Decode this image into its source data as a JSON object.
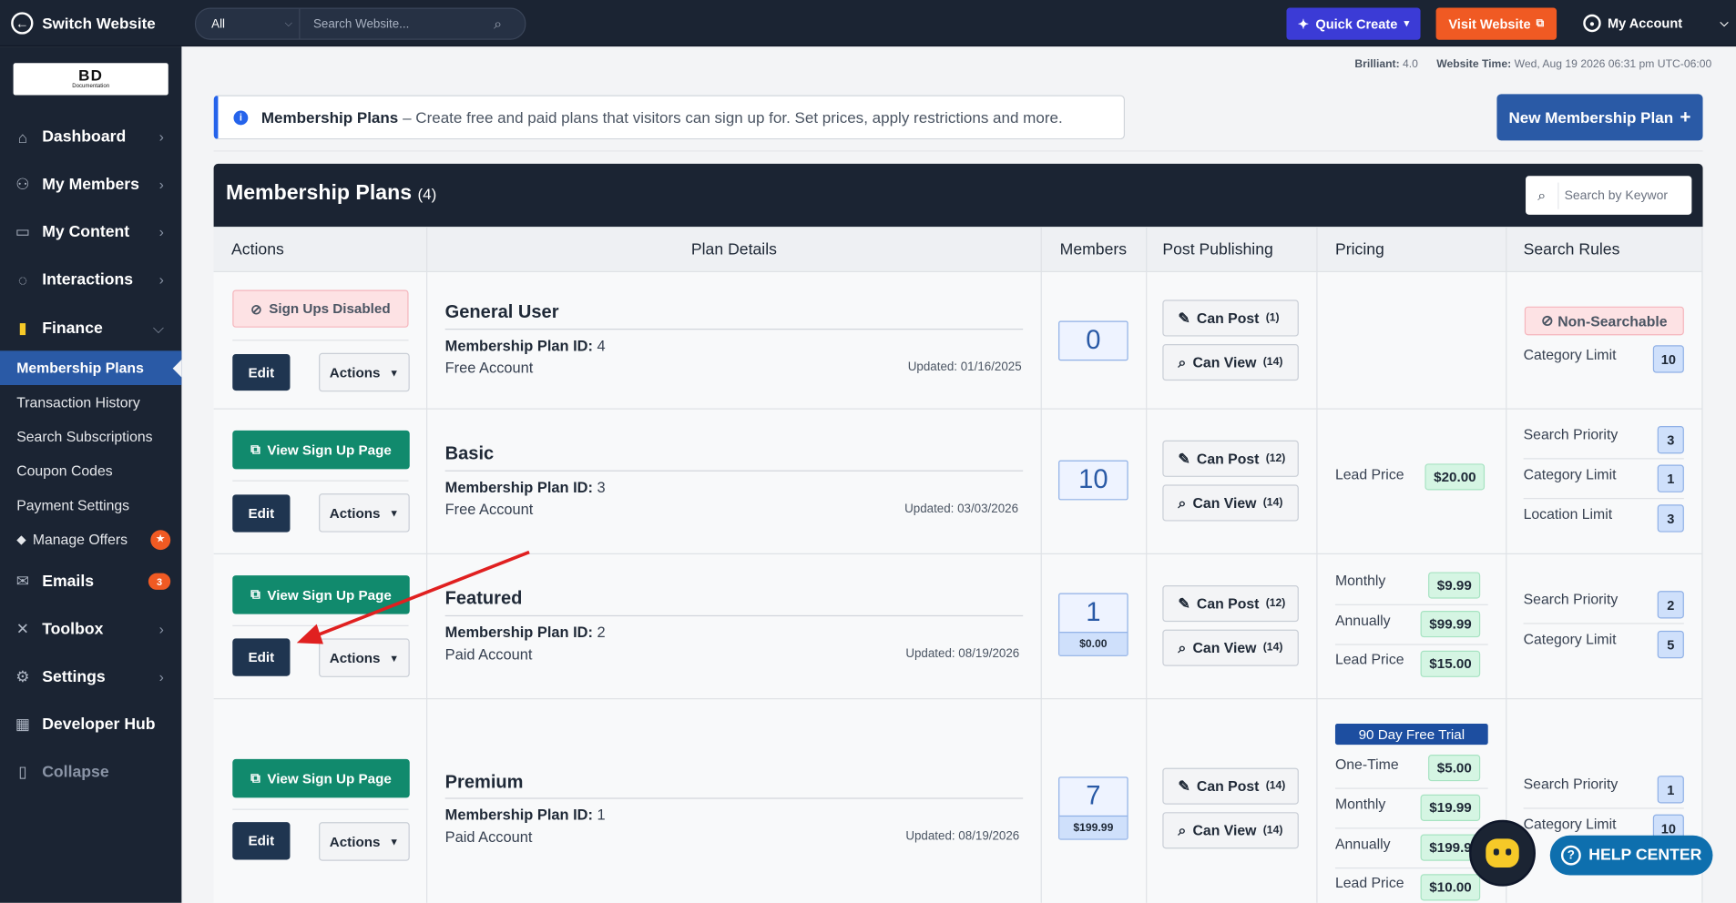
{
  "topbar": {
    "switch_label": "Switch Website",
    "scope_select": "All",
    "search_placeholder": "Search Website...",
    "quick_create": "Quick Create",
    "visit_website": "Visit Website",
    "my_account": "My Account"
  },
  "logo": {
    "text": "BD",
    "subtext": "Documentation"
  },
  "sidebar": {
    "items": [
      {
        "label": "Dashboard",
        "icon": "home-icon"
      },
      {
        "label": "My Members",
        "icon": "members-icon"
      },
      {
        "label": "My Content",
        "icon": "folder-icon"
      },
      {
        "label": "Interactions",
        "icon": "chat-icon"
      },
      {
        "label": "Finance",
        "icon": "bar-chart-icon"
      }
    ],
    "finance_sub": [
      {
        "label": "Membership Plans"
      },
      {
        "label": "Transaction History"
      },
      {
        "label": "Search Subscriptions"
      },
      {
        "label": "Coupon Codes"
      },
      {
        "label": "Payment Settings"
      },
      {
        "label": "Manage Offers"
      }
    ],
    "lower": [
      {
        "label": "Emails",
        "badge": "3"
      },
      {
        "label": "Toolbox"
      },
      {
        "label": "Settings"
      },
      {
        "label": "Developer Hub"
      },
      {
        "label": "Collapse"
      }
    ]
  },
  "status": {
    "brilliant_label": "Brilliant:",
    "brilliant_value": "4.0",
    "time_label": "Website Time:",
    "time_value": "Wed, Aug 19 2026 06:31 pm UTC-06:00"
  },
  "banner": {
    "title": "Membership Plans",
    "text": "– Create free and paid plans that visitors can sign up for. Set prices, apply restrictions and more."
  },
  "new_plan_button": "New Membership Plan",
  "card": {
    "title": "Membership Plans",
    "count": "(4)",
    "search_placeholder": "Search by Keywor"
  },
  "columns": [
    "Actions",
    "Plan Details",
    "Members",
    "Post Publishing",
    "Pricing",
    "Search Rules"
  ],
  "plans": [
    {
      "sign_up": "Sign Ups Disabled",
      "edit": "Edit",
      "actions": "Actions",
      "name": "General User",
      "id_label": "Membership Plan ID:",
      "id": "4",
      "type": "Free Account",
      "updated": "Updated: 01/16/2025",
      "members": "0",
      "can_post": "Can Post",
      "post_count": "(1)",
      "can_view": "Can View",
      "view_count": "(14)",
      "non_searchable": "Non-Searchable",
      "rules": [
        {
          "label": "Category Limit",
          "value": "10"
        }
      ]
    },
    {
      "sign_up": "View Sign Up Page",
      "edit": "Edit",
      "actions": "Actions",
      "name": "Basic",
      "id_label": "Membership Plan ID:",
      "id": "3",
      "type": "Free Account",
      "updated": "Updated: 03/03/2026",
      "members": "10",
      "can_post": "Can Post",
      "post_count": "(12)",
      "can_view": "Can View",
      "view_count": "(14)",
      "pricing": [
        {
          "label": "Lead Price",
          "value": "$20.00"
        }
      ],
      "rules": [
        {
          "label": "Search Priority",
          "value": "3"
        },
        {
          "label": "Category Limit",
          "value": "1"
        },
        {
          "label": "Location Limit",
          "value": "3"
        }
      ]
    },
    {
      "sign_up": "View Sign Up Page",
      "edit": "Edit",
      "actions": "Actions",
      "name": "Featured",
      "id_label": "Membership Plan ID:",
      "id": "2",
      "type": "Paid Account",
      "updated": "Updated: 08/19/2026",
      "members": "1",
      "members_price": "$0.00",
      "can_post": "Can Post",
      "post_count": "(12)",
      "can_view": "Can View",
      "view_count": "(14)",
      "pricing": [
        {
          "label": "Monthly",
          "value": "$9.99"
        },
        {
          "label": "Annually",
          "value": "$99.99"
        },
        {
          "label": "Lead Price",
          "value": "$15.00"
        }
      ],
      "rules": [
        {
          "label": "Search Priority",
          "value": "2"
        },
        {
          "label": "Category Limit",
          "value": "5"
        }
      ]
    },
    {
      "sign_up": "View Sign Up Page",
      "edit": "Edit",
      "actions": "Actions",
      "name": "Premium",
      "id_label": "Membership Plan ID:",
      "id": "1",
      "type": "Paid Account",
      "updated": "Updated: 08/19/2026",
      "members": "7",
      "members_price": "$199.99",
      "can_post": "Can Post",
      "post_count": "(14)",
      "can_view": "Can View",
      "view_count": "(14)",
      "trial": "90 Day Free Trial",
      "pricing": [
        {
          "label": "One-Time",
          "value": "$5.00"
        },
        {
          "label": "Monthly",
          "value": "$19.99"
        },
        {
          "label": "Annually",
          "value": "$199.9"
        },
        {
          "label": "Lead Price",
          "value": "$10.00"
        }
      ],
      "rules": [
        {
          "label": "Search Priority",
          "value": "1"
        },
        {
          "label": "Category Limit",
          "value": "10"
        }
      ]
    }
  ],
  "help_center": "HELP CENTER",
  "colors": {
    "sidebar": "#1b2433",
    "active": "#2a5aa6",
    "accent_orange": "#f05a23",
    "quick_create": "#3b3bd6",
    "green_button": "#118a6d",
    "edit_button": "#1f3550",
    "arrow": "#e02020"
  }
}
